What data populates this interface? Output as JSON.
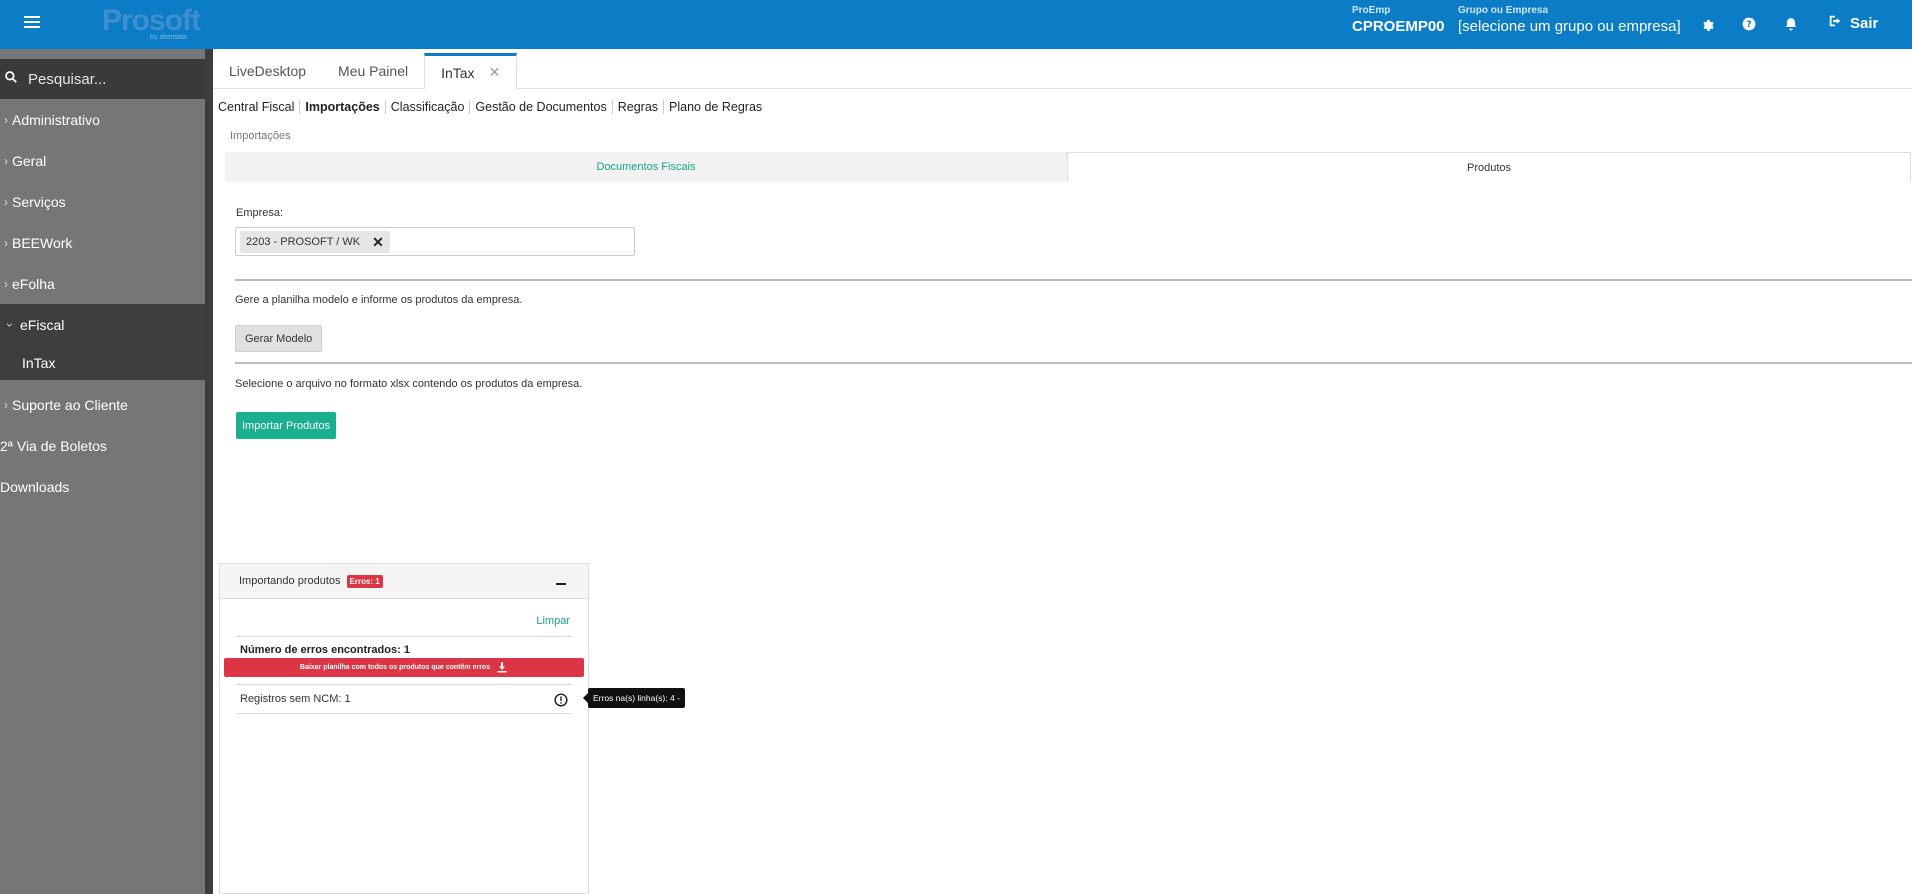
{
  "header": {
    "logo_text": "Prosoft",
    "logo_tag": "by alterdata",
    "proemp_label": "ProEmp",
    "proemp_value": "CPROEMP00",
    "grupo_label": "Grupo ou Empresa",
    "grupo_value": "[selecione um grupo ou empresa]",
    "sair_label": "Sair",
    "icons": [
      "gear-icon",
      "help-icon",
      "bell-icon",
      "logout-icon"
    ]
  },
  "sidebar": {
    "search_placeholder": "Pesquisar...",
    "items": [
      {
        "label": "Administrativo"
      },
      {
        "label": "Geral"
      },
      {
        "label": "Serviços"
      },
      {
        "label": "BEEWork"
      },
      {
        "label": "eFolha"
      },
      {
        "label": "eFiscal",
        "expanded": true,
        "children": [
          {
            "label": "InTax"
          }
        ]
      },
      {
        "label": "Suporte ao Cliente"
      },
      {
        "label": "2ª Via de Boletos"
      },
      {
        "label": "Downloads"
      }
    ]
  },
  "tabs": [
    {
      "label": "LiveDesktop"
    },
    {
      "label": "Meu Painel"
    },
    {
      "label": "InTax",
      "active": true
    }
  ],
  "subnav": [
    "Central Fiscal",
    "Importações",
    "Classificação",
    "Gestão de Documentos",
    "Regras",
    "Plano de Regras"
  ],
  "breadcrumb": "Importações",
  "inner_tabs": [
    "Documentos Fiscais",
    "Produtos"
  ],
  "form": {
    "empresa_label": "Empresa:",
    "empresa_chip": "2203 - PROSOFT / WK",
    "gerar_text": "Gere a planilha modelo e informe os produtos da empresa.",
    "gerar_button": "Gerar Modelo",
    "select_text": "Selecione o arquivo no formato xlsx contendo os produtos da empresa.",
    "import_button": "Importar Produtos"
  },
  "panel": {
    "title": "Importando produtos",
    "badge": "Erros: 1",
    "limpar": "Limpar",
    "errors_found": "Número de erros encontrados: 1",
    "download_button": "Baixar planilha com todos os produtos que contêm erros",
    "registro": "Registros sem NCM: 1",
    "tooltip": "Erros na(s) linha(s): 4 -"
  },
  "colors": {
    "header_bg": "#0a7dc6",
    "sidebar_bg": "#767676",
    "accent_green": "#1aaf8f",
    "error_red": "#dc3545"
  }
}
